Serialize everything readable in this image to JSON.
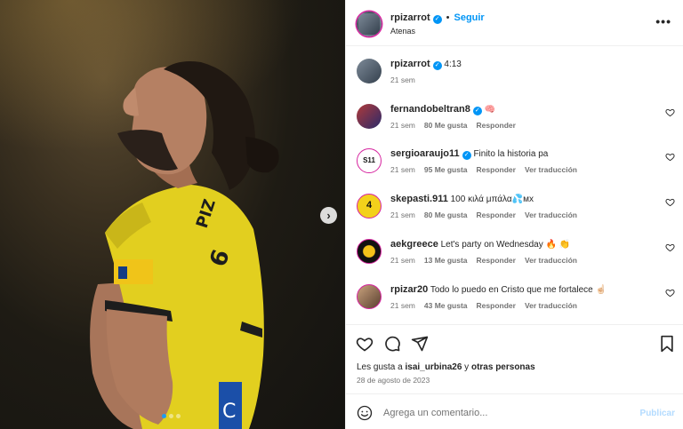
{
  "post": {
    "photo_alt": "player-photo",
    "carousel_dots": 3,
    "active_dot": 0
  },
  "header": {
    "username": "rpizarrot",
    "separator": "•",
    "follow_label": "Seguir",
    "location": "Atenas",
    "more_label": "•••"
  },
  "caption": {
    "username": "rpizarrot",
    "text": "4:13",
    "time": "21 sem"
  },
  "comments": [
    {
      "username": "fernandobeltran8",
      "verified": true,
      "text": "🧠",
      "time": "21 sem",
      "likes": "80 Me gusta",
      "reply": "Responder",
      "translate": ""
    },
    {
      "username": "sergioaraujo11",
      "verified": true,
      "text": "Finito la historia pa",
      "time": "21 sem",
      "likes": "95 Me gusta",
      "reply": "Responder",
      "translate": "Ver traducción"
    },
    {
      "username": "skepasti.911",
      "verified": false,
      "text": "100 κιλά μπάλα💦мх",
      "time": "21 sem",
      "likes": "80 Me gusta",
      "reply": "Responder",
      "translate": "Ver traducción"
    },
    {
      "username": "aekgreece",
      "verified": false,
      "text": "Let's party on Wednesday 🔥 👏",
      "time": "21 sem",
      "likes": "13 Me gusta",
      "reply": "Responder",
      "translate": "Ver traducción"
    },
    {
      "username": "rpizar20",
      "verified": false,
      "text": "Todo lo puedo en Cristo que me fortalece ☝🏻",
      "time": "21 sem",
      "likes": "43 Me gusta",
      "reply": "Responder",
      "translate": "Ver traducción"
    }
  ],
  "likes_line": {
    "prefix": "Les gusta a ",
    "user": "isai_urbina26",
    "suffix": " y ",
    "others": "otras personas"
  },
  "date": "28 de agosto de 2023",
  "add_comment": {
    "placeholder": "Agrega un comentario...",
    "publish_label": "Publicar"
  },
  "colors": {
    "accent": "#0095f6",
    "publish_disabled": "#b3dbff",
    "meta": "#737373",
    "jersey": "#e8d21e"
  },
  "icons": {
    "like": "heart-icon",
    "comment": "comment-icon",
    "share": "share-icon",
    "save": "bookmark-icon",
    "emoji": "smile-icon",
    "more": "more-icon",
    "next": "chevron-right-icon"
  }
}
